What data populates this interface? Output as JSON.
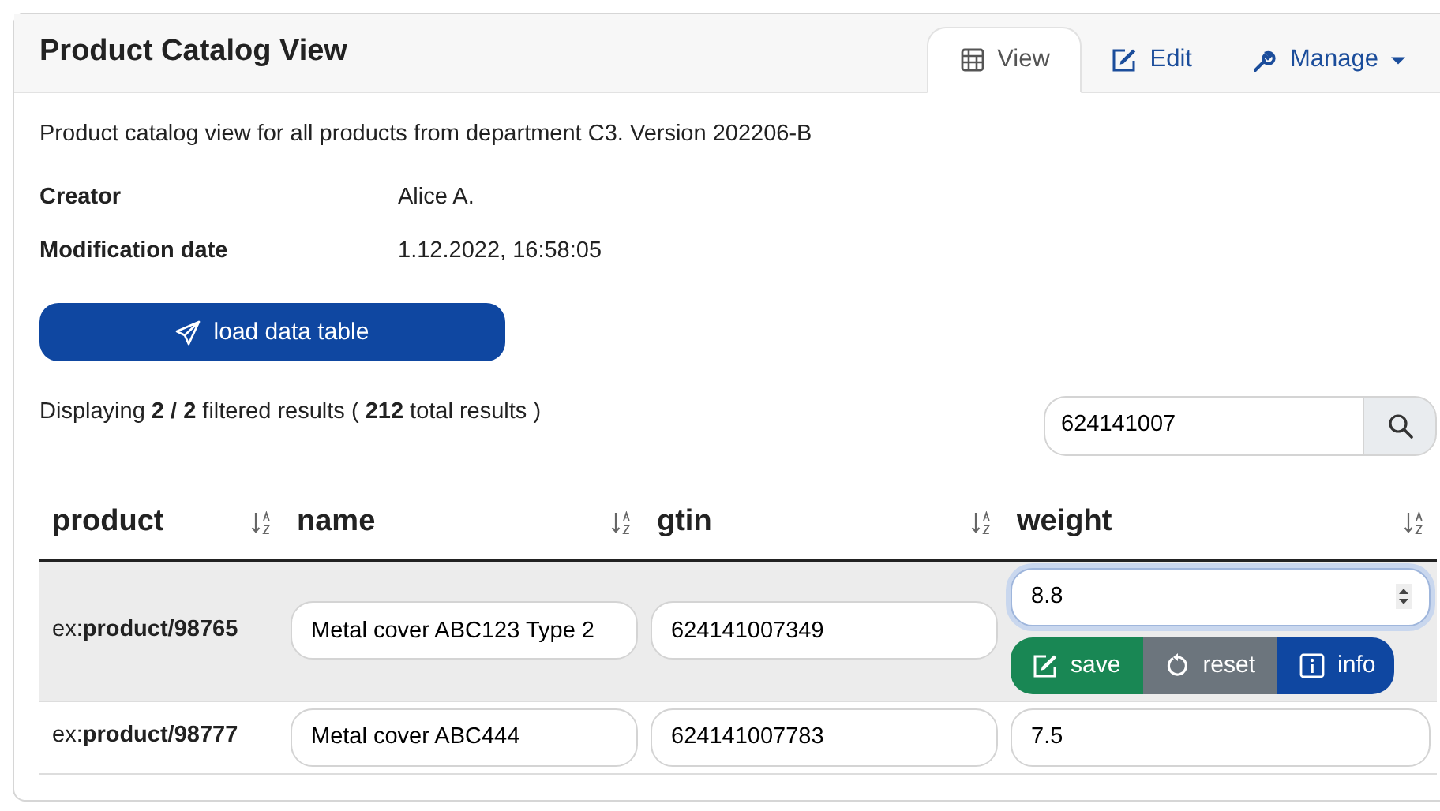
{
  "card": {
    "title": "Product Catalog View"
  },
  "tabs": [
    {
      "label": "View",
      "kind": "table",
      "selected": true
    },
    {
      "label": "Edit",
      "kind": "edit",
      "selected": false
    },
    {
      "label": "Manage",
      "kind": "manage",
      "selected": false
    }
  ],
  "description": "Product catalog view for all products from department C3. Version 202206-B",
  "details": [
    {
      "label": "Creator",
      "value": "Alice A."
    },
    {
      "label": "Modification date",
      "value": "1.12.2022, 16:58:05"
    }
  ],
  "load_button": "load data table",
  "summary": "Displaying **2 / 2** filtered results ( **212** total results )",
  "search": {
    "value": "624141007"
  },
  "table": {
    "columns": [
      "product",
      "name",
      "gtin",
      "weight"
    ],
    "rows": [
      {
        "product": "ex:**product/98765**",
        "name": "Metal cover ABC123 Type 2",
        "gtin": "624141007349",
        "weight": "8.8",
        "selected": true,
        "focused": true,
        "actions": [
          {
            "label": "save",
            "kind": "save"
          },
          {
            "label": "reset",
            "kind": "reset"
          },
          {
            "label": "info",
            "kind": "info"
          }
        ]
      },
      {
        "product": "ex:**product/98777**",
        "name": "Metal cover ABC444",
        "gtin": "624141007783",
        "weight": "7.5",
        "selected": false,
        "focused": false
      }
    ]
  }
}
